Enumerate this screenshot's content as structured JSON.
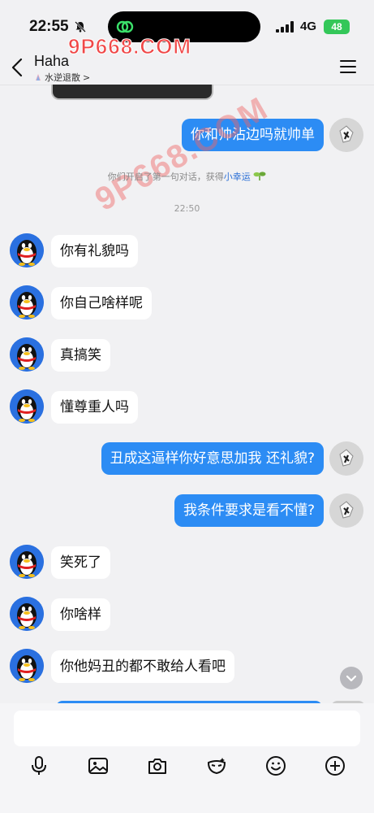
{
  "status_bar": {
    "time": "22:55",
    "network": "4G",
    "battery": "48"
  },
  "watermarks": {
    "top": "9P668.COM",
    "middle": "9P668.COM"
  },
  "header": {
    "title": "Haha",
    "subtitle": "水逆退散",
    "subtitle_chevron": ">"
  },
  "notice": {
    "text": "你们开启了第一句对话，获得",
    "link": "小幸运",
    "icon": "sprout-icon"
  },
  "timestamp": "22:50",
  "messages": [
    {
      "side": "out",
      "text": "你和帅沾边吗就帅单"
    },
    {
      "side": "in",
      "text": "你有礼貌吗"
    },
    {
      "side": "in",
      "text": "你自己啥样呢"
    },
    {
      "side": "in",
      "text": "真搞笑"
    },
    {
      "side": "in",
      "text": "懂尊重人吗"
    },
    {
      "side": "out",
      "text": "丑成这逼样你好意思加我 还礼貌?"
    },
    {
      "side": "out",
      "text": "我条件要求是看不懂?"
    },
    {
      "side": "in",
      "text": "笑死了"
    },
    {
      "side": "in",
      "text": "你啥样"
    },
    {
      "side": "in",
      "text": "你他妈丑的都不敢给人看吧"
    }
  ],
  "input": {
    "value": "",
    "placeholder": ""
  },
  "toolbar": [
    "microphone-icon",
    "image-icon",
    "camera-icon",
    "mask-icon",
    "emoji-icon",
    "plus-icon"
  ],
  "colors": {
    "accent": "#2c8cf4",
    "background": "#f1f1f3",
    "battery": "#34c759",
    "link": "#2b6fd6"
  }
}
